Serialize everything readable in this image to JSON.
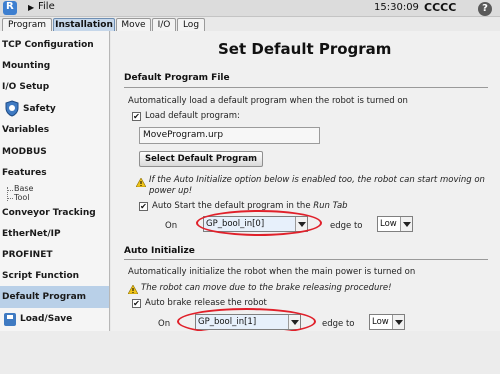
{
  "titlebar": {
    "file_label": "File",
    "time": "15:30:09",
    "robot_name": "CCCC",
    "help_label": "?"
  },
  "tabs": [
    {
      "label": "Program"
    },
    {
      "label": "Installation"
    },
    {
      "label": "Move"
    },
    {
      "label": "I/O"
    },
    {
      "label": "Log"
    }
  ],
  "sidebar": {
    "items": [
      {
        "label": "TCP Configuration"
      },
      {
        "label": "Mounting"
      },
      {
        "label": "I/O Setup"
      },
      {
        "label": "Safety"
      },
      {
        "label": "Variables"
      },
      {
        "label": "MODBUS"
      },
      {
        "label": "Features"
      },
      {
        "label": "Base"
      },
      {
        "label": "Tool"
      },
      {
        "label": "Conveyor Tracking"
      },
      {
        "label": "EtherNet/IP"
      },
      {
        "label": "PROFINET"
      },
      {
        "label": "Script Function"
      },
      {
        "label": "Default Program"
      },
      {
        "label": "Load/Save"
      }
    ]
  },
  "main": {
    "title": "Set Default Program",
    "default_program_file": {
      "heading": "Default Program File",
      "description": "Automatically load a default program when the robot is turned on",
      "load_checkbox_label": "Load default program:",
      "program_name": "MoveProgram.urp",
      "select_button": "Select Default Program",
      "warning_line1": "If the Auto Initialize option below is enabled too, the robot can start moving on",
      "warning_line2": "power up!",
      "auto_start_prefix": "Auto Start the default program in the ",
      "auto_start_tab": "Run Tab",
      "on_label": "On",
      "input_value": "GP_bool_in[0]",
      "edge_label": "edge to",
      "edge_value": "Low"
    },
    "auto_initialize": {
      "heading": "Auto Initialize",
      "description": "Automatically initialize the robot when the main power is turned on",
      "warning": "The robot can move due to the brake releasing procedure!",
      "brake_checkbox_label": "Auto brake release the robot",
      "on_label": "On",
      "input_value": "GP_bool_in[1]",
      "edge_label": "edge to",
      "edge_value": "Low"
    }
  },
  "colors": {
    "active_tab": "#c6d7ea",
    "active_nav": "#b9d0e8",
    "annotation_oval": "#e0202a"
  }
}
